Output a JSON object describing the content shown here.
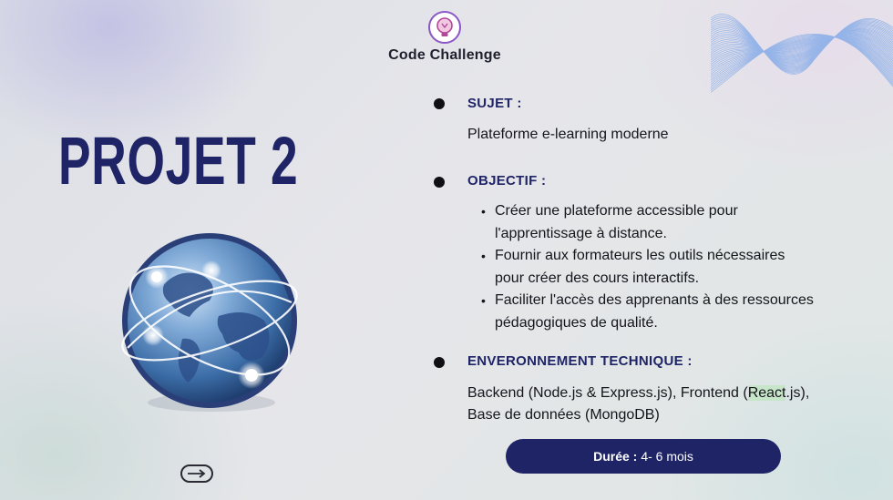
{
  "header": {
    "brand": "Code Challenge",
    "logo_icon": "lightbulb-logo-icon"
  },
  "slide": {
    "title": "PROJET 2",
    "illustration": "globe-network-icon",
    "next_icon": "arrow-right-icon"
  },
  "sections": {
    "subject": {
      "heading": "SUJET :",
      "text": "Plateforme e-learning moderne"
    },
    "objective": {
      "heading": "OBJECTIF :",
      "items": [
        {
          "line1": "Créer une plateforme accessible pour",
          "line2": "l'apprentissage à distance."
        },
        {
          "line1": "Fournir aux formateurs les outils nécessaires",
          "line2": "pour créer des cours interactifs."
        },
        {
          "line1": "Faciliter l'accès des apprenants à des ressources",
          "line2": "pédagogiques de qualité."
        }
      ]
    },
    "environment": {
      "heading": "ENVERONNEMENT TECHNIQUE :",
      "line1_pre": "Backend (Node.js & Express.js), Frontend (",
      "line1_highlight": "React",
      "line1_post": ".js),",
      "line2": "Base de données (MongoDB)"
    }
  },
  "duration": {
    "label": "Durée :",
    "value": "4- 6 mois"
  },
  "colors": {
    "accent": "#1e2466",
    "logo_ring": "#8a58c6"
  }
}
